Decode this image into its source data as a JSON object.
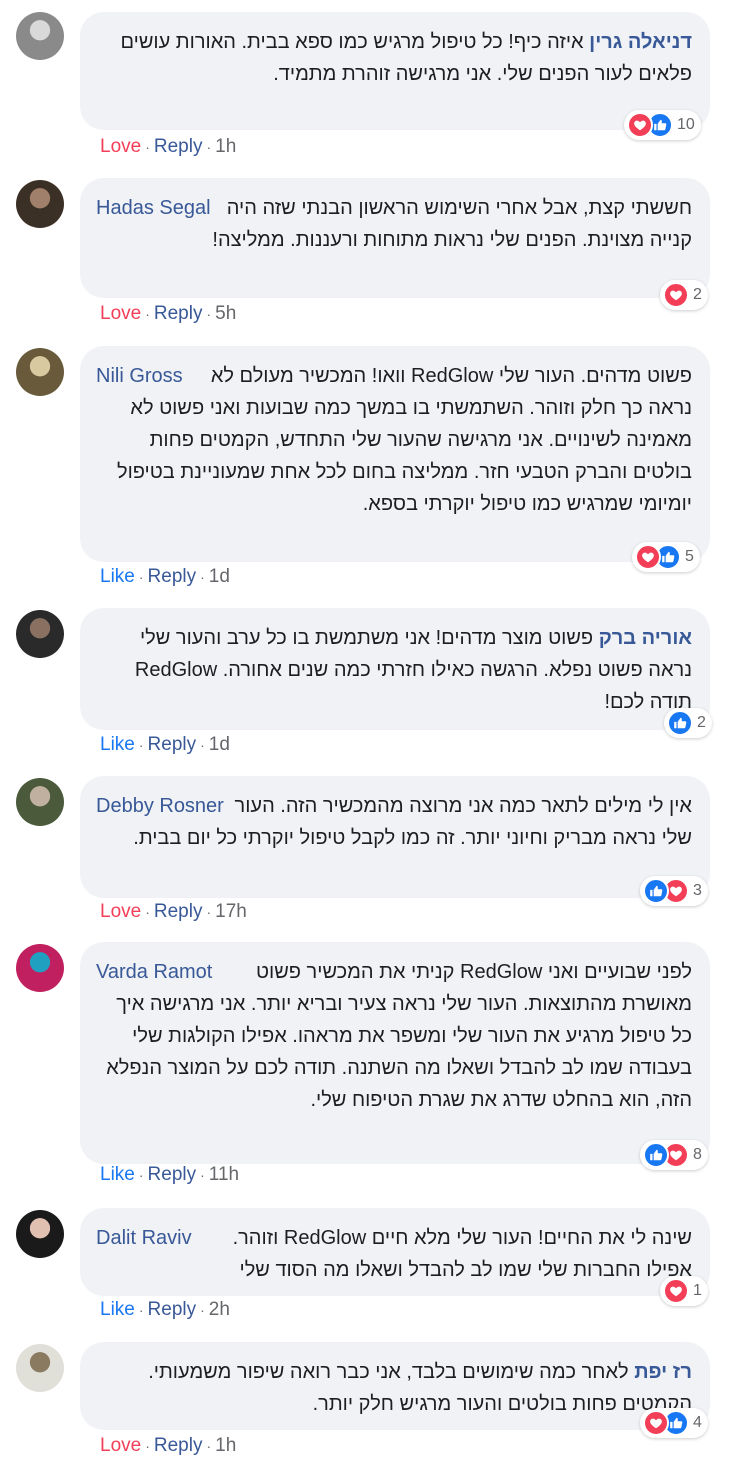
{
  "colors": {
    "love": "#f33e58",
    "like": "#1877f2",
    "name": "#385898",
    "bubble": "#f0f2f5"
  },
  "comments": [
    {
      "name": "דניאלה גרין",
      "text": "איזה כיף! כל טיפול מרגיש כמו ספא בבית. האורות עושים פלאים לעור הפנים שלי. אני מרגישה זוהרת מתמיד.",
      "reaction_count": "10",
      "reaction_icons": [
        "love",
        "like"
      ],
      "action": "Love",
      "reply": "Reply",
      "time": "1h"
    },
    {
      "name": "Hadas Segal",
      "text": "חששתי קצת, אבל אחרי השימוש הראשון הבנתי שזה היה קנייה מצוינת. הפנים שלי נראות מתוחות ורעננות. ממליצה!",
      "reaction_count": "2",
      "reaction_icons": [
        "love"
      ],
      "action": "Love",
      "reply": "Reply",
      "time": "5h"
    },
    {
      "name": "Nili Gross",
      "text": "פשוט מדהים. העור שלי RedGlow וואו! המכשיר מעולם לא נראה כך חלק וזוהר. השתמשתי בו במשך כמה שבועות ואני פשוט לא מאמינה לשינויים. אני מרגישה שהעור שלי התחדש, הקמטים פחות בולטים והברק הטבעי חזר. ממליצה בחום לכל אחת שמעוניינת בטיפול יומיומי שמרגיש כמו טיפול יוקרתי בספא.",
      "reaction_count": "5",
      "reaction_icons": [
        "love",
        "like"
      ],
      "action": "Like",
      "reply": "Reply",
      "time": "1d"
    },
    {
      "name": "אוריה ברק",
      "text": "פשוט מוצר מדהים! אני משתמשת בו כל ערב והעור שלי נראה פשוט נפלא. הרגשה כאילו חזרתי כמה שנים אחורה. RedGlow תודה לכם!",
      "reaction_count": "2",
      "reaction_icons": [
        "like"
      ],
      "action": "Like",
      "reply": "Reply",
      "time": "1d"
    },
    {
      "name": "Debby Rosner",
      "text": "אין לי מילים לתאר כמה אני מרוצה מהמכשיר הזה. העור שלי נראה מבריק וחיוני יותר. זה כמו לקבל טיפול יוקרתי כל יום בבית.",
      "reaction_count": "3",
      "reaction_icons": [
        "like",
        "love"
      ],
      "action": "Love",
      "reply": "Reply",
      "time": "17h"
    },
    {
      "name": "Varda Ramot",
      "text": "לפני שבועיים ואני RedGlow קניתי את המכשיר פשוט מאושרת מהתוצאות. העור שלי נראה צעיר ובריא יותר. אני מרגישה איך כל טיפול מרגיע את העור שלי ומשפר את מראהו. אפילו הקולגות שלי בעבודה שמו לב להבדל ושאלו מה השתנה. תודה לכם על המוצר הנפלא הזה, הוא בהחלט שדרג את שגרת הטיפוח שלי.",
      "reaction_count": "8",
      "reaction_icons": [
        "like",
        "love"
      ],
      "action": "Like",
      "reply": "Reply",
      "time": "11h"
    },
    {
      "name": "Dalit Raviv",
      "text": "שינה לי את החיים! העור שלי מלא חיים RedGlow וזוהר. אפילו החברות שלי שמו לב להבדל ושאלו מה הסוד שלי",
      "reaction_count": "1",
      "reaction_icons": [
        "love"
      ],
      "action": "Like",
      "reply": "Reply",
      "time": "2h"
    },
    {
      "name": "רז יפת",
      "text": "לאחר כמה שימושים בלבד, אני כבר רואה שיפור משמעותי. הקמטים פחות בולטים והעור מרגיש חלק יותר.",
      "reaction_count": "4",
      "reaction_icons": [
        "love",
        "like"
      ],
      "action": "Love",
      "reply": "Reply",
      "time": "1h"
    }
  ]
}
